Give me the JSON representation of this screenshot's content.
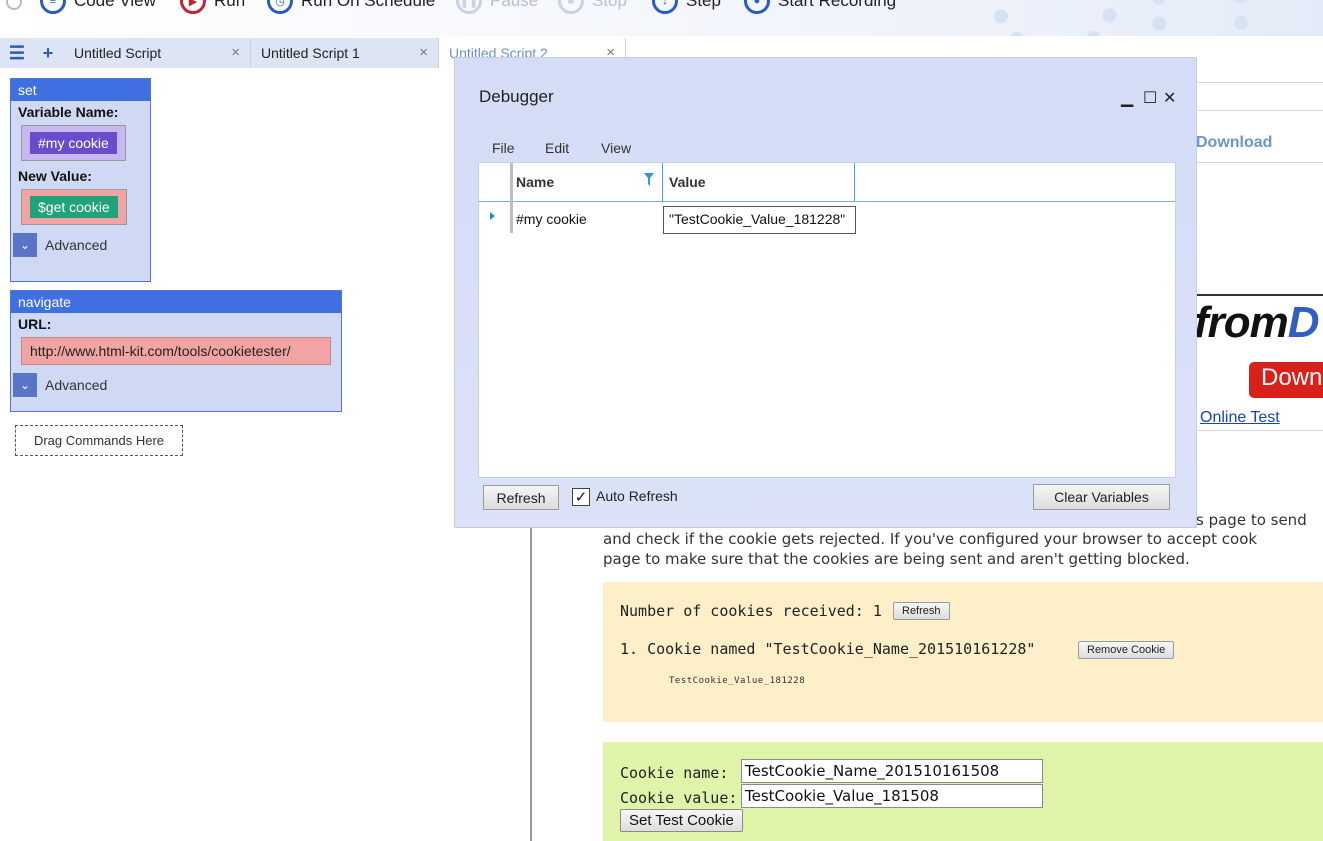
{
  "toolbar": {
    "items": [
      {
        "label": "Code View",
        "icon": "code-view-icon"
      },
      {
        "label": "Run",
        "icon": "run-icon"
      },
      {
        "label": "Run On Schedule",
        "icon": "schedule-icon"
      },
      {
        "label": "Pause",
        "icon": "pause-icon"
      },
      {
        "label": "Stop",
        "icon": "stop-icon"
      },
      {
        "label": "Step",
        "icon": "step-icon"
      },
      {
        "label": "Start Recording",
        "icon": "record-icon"
      }
    ]
  },
  "tabs": {
    "menu_glyph": "☰",
    "add_glyph": "+",
    "close_glyph": "×",
    "items": [
      {
        "label": "Untitled Script"
      },
      {
        "label": "Untitled Script 1"
      },
      {
        "label": "Untitled Script 2"
      }
    ]
  },
  "editor": {
    "set_command": {
      "title": "set",
      "variable_label": "Variable Name:",
      "variable_value": "#my cookie",
      "new_value_label": "New Value:",
      "new_value": "$get cookie",
      "advanced": "Advanced"
    },
    "navigate_command": {
      "title": "navigate",
      "url_label": "URL:",
      "url_value": "http://www.html-kit.com/tools/cookietester/",
      "advanced": "Advanced"
    },
    "drag_hint": "Drag Commands Here"
  },
  "browser": {
    "download_link": "Download",
    "ad_logo_a": "from",
    "ad_logo_b": "D",
    "ad_button": "Down",
    "online_test": "Online Test",
    "para_line1": "s page to send",
    "para_line2": "and check if the cookie gets rejected. If you've configured your browser to accept cook",
    "para_line3": "page to make sure that the cookies are being sent and aren't getting blocked.",
    "cookies_received_label": "Number of cookies received: 1",
    "refresh_label": "Refresh",
    "cookie_item": "1. Cookie named \"TestCookie_Name_201510161228\"",
    "remove_cookie_label": "Remove Cookie",
    "cookie_item_value": "TestCookie_Value_181228",
    "cookie_name_label": "Cookie name:",
    "cookie_name_value": "TestCookie_Name_201510161508",
    "cookie_value_label": "Cookie value:",
    "cookie_value_value": "TestCookie_Value_181508",
    "set_cookie_button": "Set Test Cookie"
  },
  "debugger": {
    "title": "Debugger",
    "minimize": "▁",
    "maximize": "☐",
    "close": "✕",
    "menu": [
      "File",
      "Edit",
      "View"
    ],
    "columns": {
      "name": "Name",
      "value": "Value"
    },
    "rows": [
      {
        "name": "#my cookie",
        "value": "\"TestCookie_Value_181228\""
      }
    ],
    "refresh_button": "Refresh",
    "auto_refresh_label": "Auto Refresh",
    "auto_refresh_checked": "✓",
    "clear_button": "Clear Variables"
  },
  "colors": {
    "accent_blue": "#3f6fe0",
    "variable_chip": "#6a4bc9",
    "function_chip": "#1fa37a",
    "url_box": "#f2a3a3",
    "cookie_panel": "#fdf0c8",
    "set_panel": "#dff4a8"
  }
}
